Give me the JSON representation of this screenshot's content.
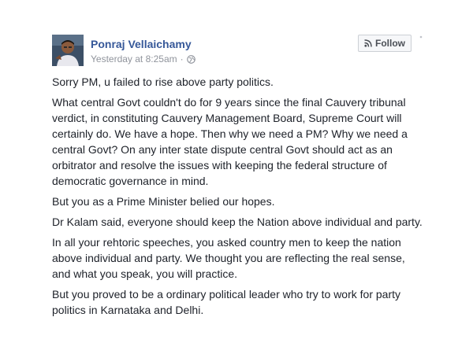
{
  "post": {
    "author_name": "Ponraj Vellaichamy",
    "timestamp": "Yesterday at 8:25am",
    "separator": "·",
    "privacy_icon": "globe-icon",
    "follow_label": "Follow",
    "follow_icon": "rss-icon",
    "paragraphs": [
      "Sorry PM, u failed to rise above party politics.",
      "What central Govt couldn't do for 9 years since the final Cauvery tribunal verdict, in constituting Cauvery Management Board, Supreme Court will certainly do. We have a hope. Then why we need a PM? Why we need a central Govt? On any inter state dispute central Govt should act as an orbitrator and resolve the issues with keeping the federal structure of democratic governance in mind.",
      "But you as a Prime Minister belied our hopes.",
      "Dr Kalam said, everyone should keep the Nation above individual and party.",
      "In all your rehtoric speeches, you asked country men to keep the nation above individual and party. We thought you are reflecting the real sense, and what you speak, you will practice.",
      "But you proved to be a ordinary political leader who try to work for party politics in Karnataka and Delhi."
    ]
  },
  "colors": {
    "author_link": "#365899",
    "meta_text": "#90949c",
    "body_text": "#1d2129",
    "button_bg": "#f6f7f9",
    "button_border": "#ccd0d5"
  }
}
